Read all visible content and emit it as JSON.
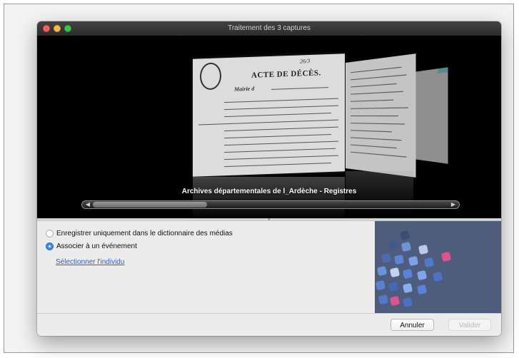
{
  "window": {
    "title": "Traitement des 3 captures"
  },
  "viewer": {
    "caption": "Archives départementales de l_Ardèche - Registres",
    "document": {
      "heading": "ACTE DE DÉCÈS.",
      "subheading": "Mairie d",
      "annotation": "26/3"
    }
  },
  "options": {
    "radio_dictionary_label": "Enregistrer uniquement dans le dictionnaire des médias",
    "radio_event_label": "Associer à un événement",
    "selected": "event",
    "select_person_link": "Sélectionner l'individu"
  },
  "footer": {
    "cancel_label": "Annuler",
    "validate_label": "Valider"
  },
  "colors": {
    "accent": "#3b8cf0",
    "link": "#2a5fd0",
    "art_background": "#4e5d7c"
  }
}
